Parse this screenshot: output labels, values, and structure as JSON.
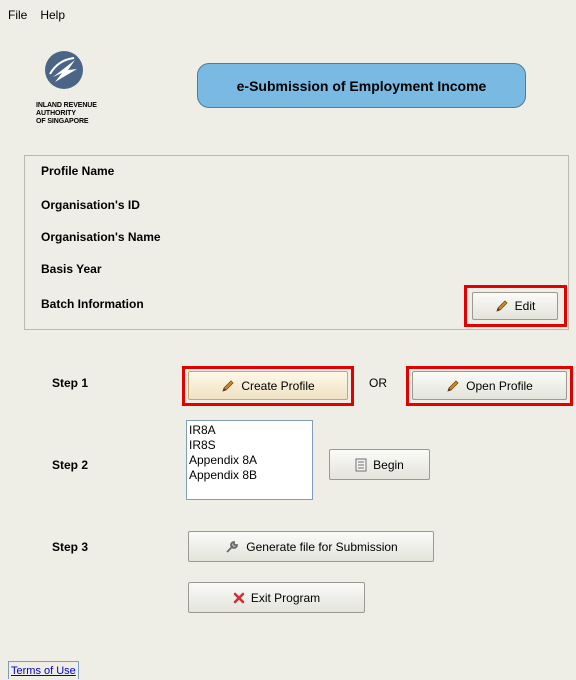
{
  "menu": {
    "file": "File",
    "help": "Help"
  },
  "logo": {
    "line1": "INLAND REVENUE",
    "line2": "AUTHORITY",
    "line3": "OF SINGAPORE"
  },
  "title": "e-Submission of Employment Income",
  "profile": {
    "profile_name": "Profile Name",
    "org_id": "Organisation's ID",
    "org_name": "Organisation's Name",
    "basis_year": "Basis Year",
    "batch_info": "Batch Information",
    "edit_label": "Edit"
  },
  "step1": {
    "label": "Step 1",
    "create_label": "Create Profile",
    "or": "OR",
    "open_label": "Open Profile"
  },
  "step2": {
    "label": "Step 2",
    "forms": [
      "IR8A",
      "IR8S",
      "Appendix 8A",
      "Appendix 8B"
    ],
    "begin_label": "Begin"
  },
  "step3": {
    "label": "Step 3",
    "generate_label": "Generate file for Submission"
  },
  "exit_label": "Exit Program",
  "terms_label": "Terms of Use",
  "colors": {
    "title_bg": "#79b9e2",
    "highlight": "#e20000",
    "background": "#eeeee6"
  }
}
